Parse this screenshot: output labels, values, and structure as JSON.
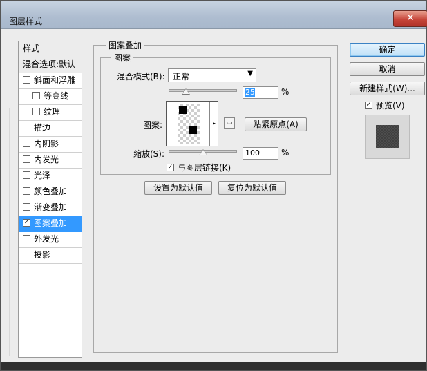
{
  "window": {
    "title": "图层样式",
    "close_label": "✕"
  },
  "left_panel": {
    "items": [
      {
        "label": "样式",
        "type": "header"
      },
      {
        "label": "混合选项:默认",
        "type": "header"
      },
      {
        "label": "斜面和浮雕",
        "checked": false
      },
      {
        "label": "等高线",
        "checked": false,
        "indent": true
      },
      {
        "label": "纹理",
        "checked": false,
        "indent": true
      },
      {
        "label": "描边",
        "checked": false
      },
      {
        "label": "内阴影",
        "checked": false
      },
      {
        "label": "内发光",
        "checked": false
      },
      {
        "label": "光泽",
        "checked": false
      },
      {
        "label": "颜色叠加",
        "checked": false
      },
      {
        "label": "渐变叠加",
        "checked": false
      },
      {
        "label": "图案叠加",
        "checked": true,
        "selected": true
      },
      {
        "label": "外发光",
        "checked": false
      },
      {
        "label": "投影",
        "checked": false
      }
    ]
  },
  "main": {
    "group_title": "图案叠加",
    "subgroup_title": "图案",
    "blend_mode_label": "混合模式(B):",
    "blend_mode_value": "正常",
    "opacity_value": "25",
    "opacity_unit": "%",
    "opacity_level": 25,
    "pattern_label": "图案:",
    "snap_origin_button": "贴紧原点(A)",
    "scale_label": "缩放(S):",
    "scale_value": "100",
    "scale_unit": "%",
    "scale_level": 50,
    "link_checkbox_label": "与图层链接(K)",
    "link_checked": true,
    "set_default_button": "设置为默认值",
    "reset_default_button": "复位为默认值"
  },
  "right": {
    "ok_button": "确定",
    "cancel_button": "取消",
    "new_style_button": "新建样式(W)...",
    "preview_label": "预览(V)",
    "preview_checked": true
  },
  "colors": {
    "selection": "#3399ff",
    "dialog_bg": "#ececec",
    "title_bar": "#b4c2d4"
  }
}
